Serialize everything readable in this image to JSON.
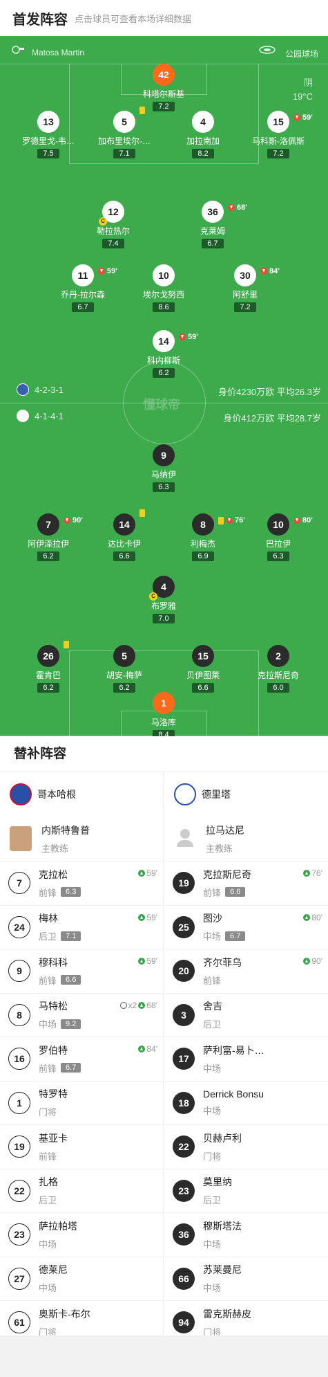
{
  "header": {
    "title": "首发阵容",
    "subtitle": "点击球员可查看本场详细数据"
  },
  "pitch": {
    "referee": "Matosa Martin",
    "stadium": "公园球场",
    "weather": "阴",
    "temperature": "19°C",
    "watermark": "懂球帝",
    "home": {
      "formation": "4-2-3-1",
      "value": "身价4230万欧  平均26.3岁"
    },
    "away": {
      "formation": "4-1-4-1",
      "value": "身价412万欧    平均28.7岁"
    }
  },
  "home_players": [
    {
      "num": "42",
      "name": "科塔尔斯基",
      "rating": "7.2",
      "gk": true
    },
    {
      "num": "13",
      "name": "罗德里戈-韦…",
      "rating": "7.5"
    },
    {
      "num": "5",
      "name": "加布里埃尔-…",
      "rating": "7.1",
      "yellow": true
    },
    {
      "num": "4",
      "name": "加拉南加",
      "rating": "8.2"
    },
    {
      "num": "15",
      "name": "马科斯-洛佩斯",
      "rating": "7.2",
      "sub": "59'"
    },
    {
      "num": "12",
      "name": "勒拉热尔",
      "rating": "7.4",
      "captain": "C"
    },
    {
      "num": "36",
      "name": "克莱姆",
      "rating": "6.7",
      "sub": "68'"
    },
    {
      "num": "11",
      "name": "乔丹-拉尔森",
      "rating": "6.7",
      "sub": "59'"
    },
    {
      "num": "10",
      "name": "埃尔戈努西",
      "rating": "8.6"
    },
    {
      "num": "30",
      "name": "阿舒里",
      "rating": "7.2",
      "sub": "84'"
    },
    {
      "num": "14",
      "name": "科内柳斯",
      "rating": "6.2",
      "sub": "59'"
    }
  ],
  "away_players": [
    {
      "num": "9",
      "name": "马纳伊",
      "rating": "6.3"
    },
    {
      "num": "7",
      "name": "阿伊泽拉伊",
      "rating": "6.2",
      "sub": "90'"
    },
    {
      "num": "14",
      "name": "达比卡伊",
      "rating": "6.6",
      "yellow": true
    },
    {
      "num": "8",
      "name": "利梅杰",
      "rating": "6.9",
      "yellow": true,
      "sub": "76'"
    },
    {
      "num": "10",
      "name": "巴拉伊",
      "rating": "6.3",
      "sub": "80'"
    },
    {
      "num": "4",
      "name": "布罗雅",
      "rating": "7.0",
      "captain": "C"
    },
    {
      "num": "26",
      "name": "霍肯巴",
      "rating": "6.2",
      "yellow": true
    },
    {
      "num": "5",
      "name": "胡安-梅萨",
      "rating": "6.2"
    },
    {
      "num": "15",
      "name": "贝伊图莱",
      "rating": "6.6"
    },
    {
      "num": "2",
      "name": "克拉斯尼奇",
      "rating": "6.0"
    },
    {
      "num": "1",
      "name": "马洛库",
      "rating": "8.4",
      "gk": true
    }
  ],
  "subs": {
    "title": "替补阵容",
    "home": {
      "team": "哥本哈根",
      "coach": "内斯特鲁普",
      "coach_role": "主教练",
      "players": [
        {
          "num": "7",
          "name": "克拉松",
          "pos": "前锋",
          "rating": "6.3",
          "on": "59'"
        },
        {
          "num": "24",
          "name": "梅林",
          "pos": "后卫",
          "rating": "7.1",
          "on": "59'"
        },
        {
          "num": "9",
          "name": "穆科科",
          "pos": "前锋",
          "rating": "6.6",
          "on": "59'"
        },
        {
          "num": "8",
          "name": "马特松",
          "pos": "中场",
          "rating": "9.2",
          "on": "68'",
          "goals": "x2"
        },
        {
          "num": "16",
          "name": "罗伯特",
          "pos": "前锋",
          "rating": "6.7",
          "on": "84'"
        },
        {
          "num": "1",
          "name": "特罗特",
          "pos": "门将"
        },
        {
          "num": "19",
          "name": "基亚卡",
          "pos": "前锋"
        },
        {
          "num": "22",
          "name": "扎格",
          "pos": "后卫"
        },
        {
          "num": "23",
          "name": "萨拉帕塔",
          "pos": "中场"
        },
        {
          "num": "27",
          "name": "德莱尼",
          "pos": "中场"
        },
        {
          "num": "61",
          "name": "奥斯卡-布尔",
          "pos": "门将"
        }
      ]
    },
    "away": {
      "team": "德里塔",
      "coach": "拉马达尼",
      "coach_role": "主教练",
      "players": [
        {
          "num": "19",
          "name": "克拉斯尼奇",
          "pos": "前锋",
          "rating": "6.6",
          "on": "76'"
        },
        {
          "num": "25",
          "name": "图沙",
          "pos": "中场",
          "rating": "6.7",
          "on": "80'"
        },
        {
          "num": "20",
          "name": "齐尔菲乌",
          "pos": "前锋",
          "on": "90'"
        },
        {
          "num": "3",
          "name": "舍吉",
          "pos": "后卫"
        },
        {
          "num": "17",
          "name": "萨利富-易卜…",
          "pos": "中场"
        },
        {
          "num": "18",
          "name": "Derrick Bonsu",
          "pos": "中场"
        },
        {
          "num": "22",
          "name": "贝赫卢利",
          "pos": "门将"
        },
        {
          "num": "23",
          "name": "莫里纳",
          "pos": "后卫"
        },
        {
          "num": "36",
          "name": "穆斯塔法",
          "pos": "中场"
        },
        {
          "num": "66",
          "name": "苏莱曼尼",
          "pos": "中场"
        },
        {
          "num": "94",
          "name": "雷克斯赫皮",
          "pos": "门将"
        }
      ]
    }
  }
}
